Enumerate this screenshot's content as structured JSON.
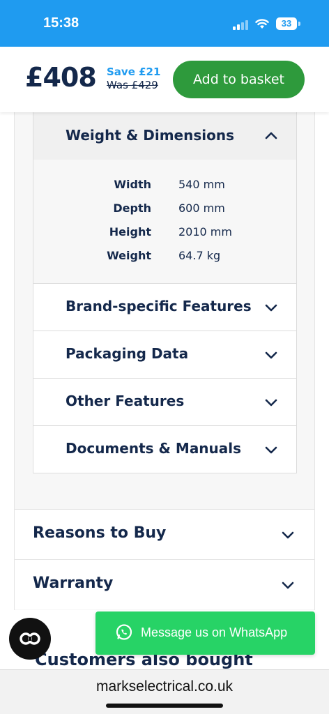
{
  "status_bar": {
    "time": "15:38",
    "battery": "33",
    "icons": [
      "signal-icon",
      "wifi-icon",
      "battery-icon"
    ]
  },
  "header": {
    "price": "£408",
    "save": "Save £21",
    "was": "Was £429",
    "basket_label": "Add to basket"
  },
  "specs_section": {
    "title": "Weight & Dimensions",
    "expanded": true,
    "rows": [
      {
        "label": "Width",
        "value": "540 mm"
      },
      {
        "label": "Depth",
        "value": "600 mm"
      },
      {
        "label": "Height",
        "value": "2010 mm"
      },
      {
        "label": "Weight",
        "value": "64.7 kg"
      }
    ]
  },
  "sub_accordions": [
    {
      "label": "Brand-specific Features"
    },
    {
      "label": "Packaging Data"
    },
    {
      "label": "Other Features"
    },
    {
      "label": "Documents & Manuals"
    }
  ],
  "outer_accordions": [
    {
      "label": "Reasons to Buy"
    },
    {
      "label": "Warranty"
    }
  ],
  "customers_heading": "Customers also bought",
  "whatsapp": {
    "label": "Message us on WhatsApp"
  },
  "browser": {
    "url": "markselectrical.co.uk"
  },
  "colors": {
    "status_bar": "#1f9bf0",
    "navy_text": "#14284b",
    "save_blue": "#1f9bf0",
    "basket_green": "#2e9a3c",
    "whatsapp_green": "#27d366"
  }
}
